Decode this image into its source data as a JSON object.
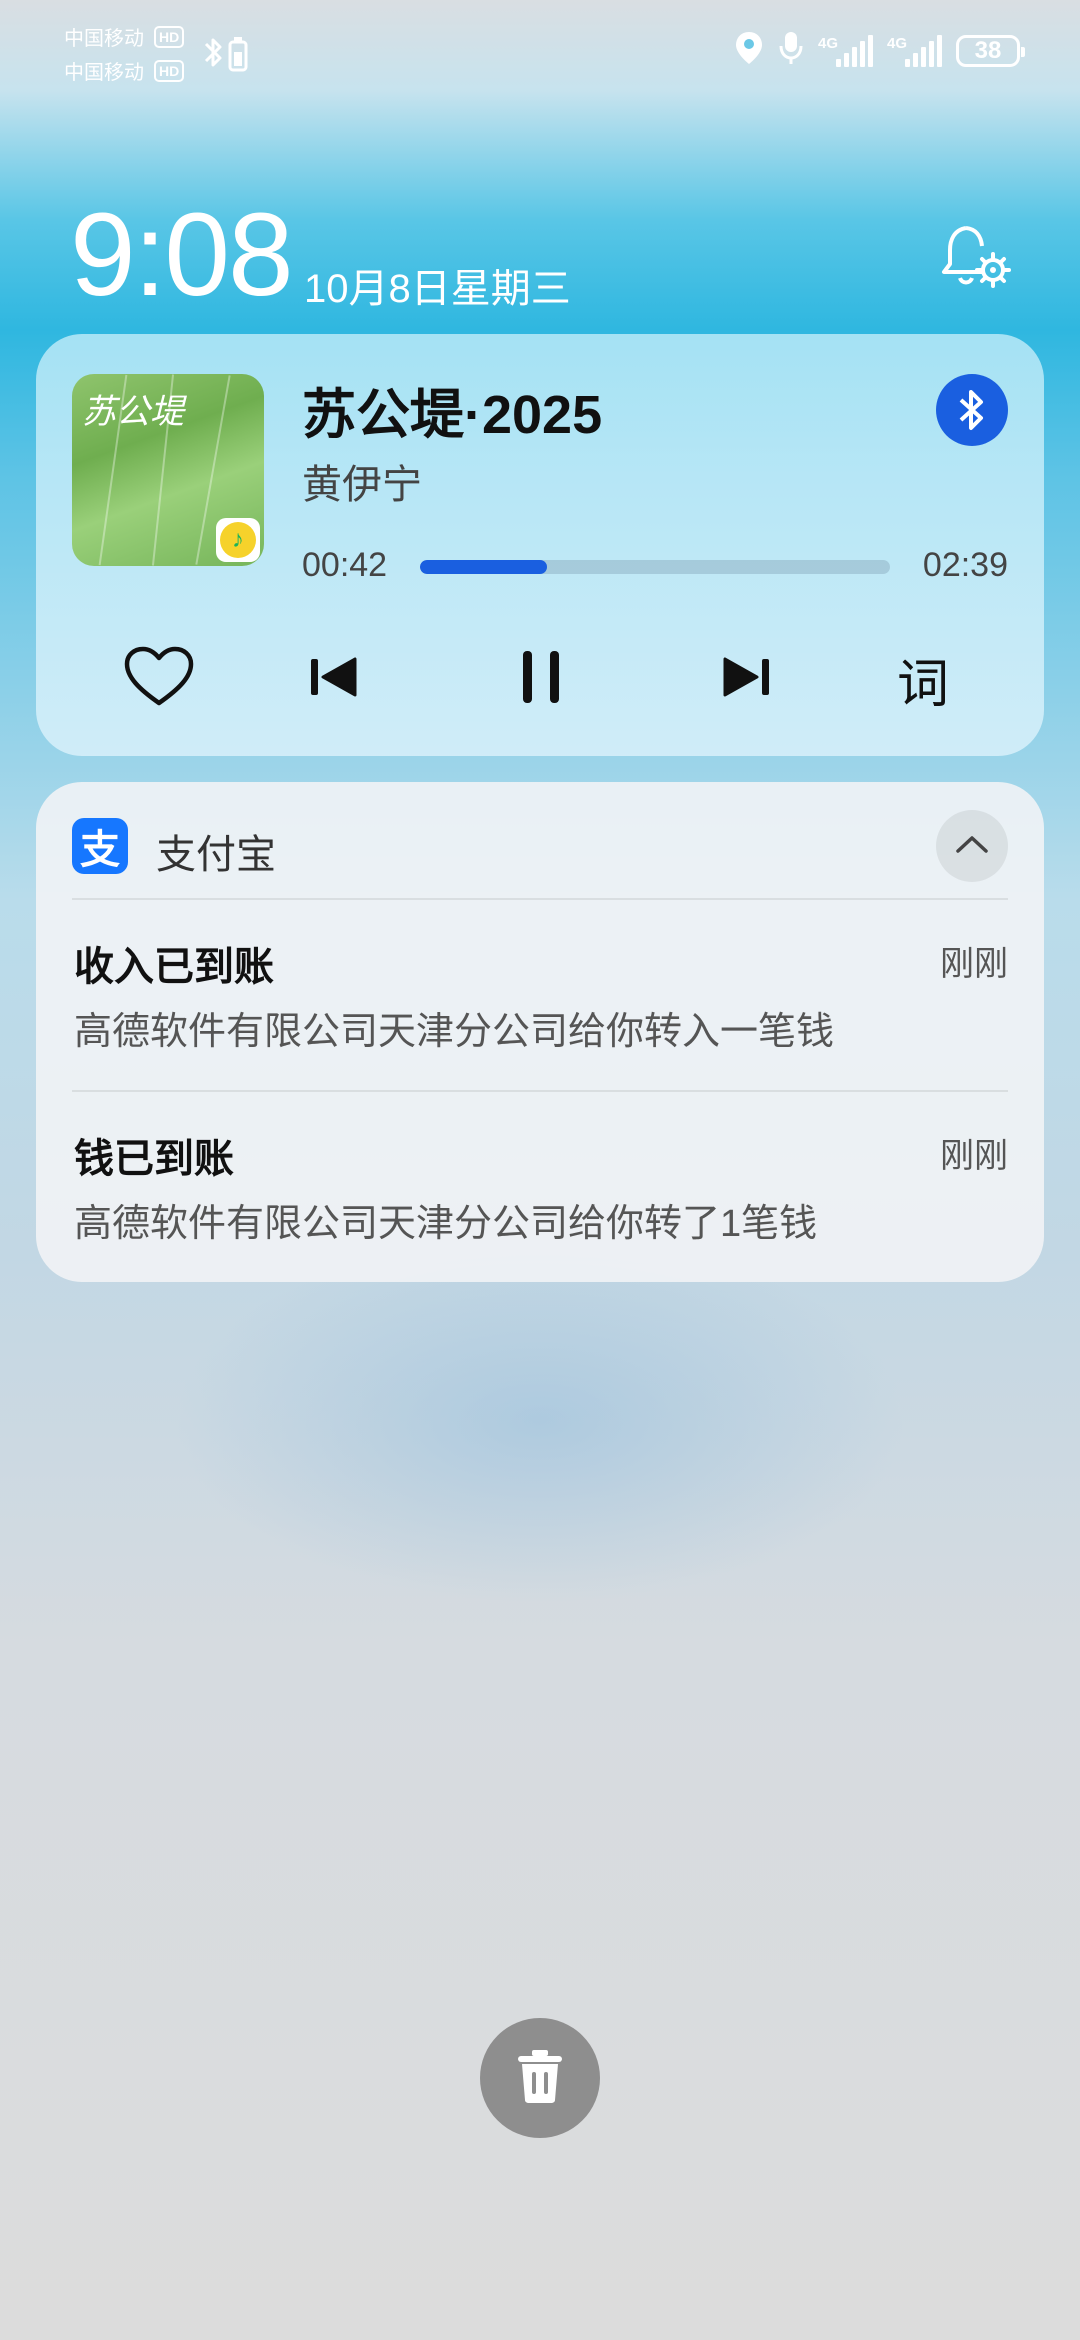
{
  "status_bar": {
    "carrier_1": "中国移动",
    "carrier_2": "中国移动",
    "hd_label": "HD",
    "signal_1_label": "4G",
    "signal_2_label": "4G",
    "battery": "38",
    "icons": [
      "bluetooth-battery-icon",
      "location-icon",
      "microphone-icon",
      "signal-icon",
      "battery-icon"
    ]
  },
  "lockscreen": {
    "time": "9:08",
    "date": "10月8日星期三"
  },
  "music_card": {
    "song_title": "苏公堤·2025",
    "artist": "黄伊宁",
    "cover_text": "苏公堤",
    "current_time": "00:42",
    "total_time": "02:39",
    "progress": 0.27,
    "lyrics_label": "词",
    "accent": "#1a5fe0"
  },
  "notification_card": {
    "app_name": "支付宝",
    "app_icon_glyph": "支",
    "app_color": "#1677ff",
    "items": [
      {
        "title": "收入已到账",
        "body": "高德软件有限公司天津分公司给你转入一笔钱",
        "time": "刚刚"
      },
      {
        "title": "钱已到账",
        "body": "高德软件有限公司天津分公司给你转了1笔钱",
        "time": "刚刚"
      }
    ]
  }
}
